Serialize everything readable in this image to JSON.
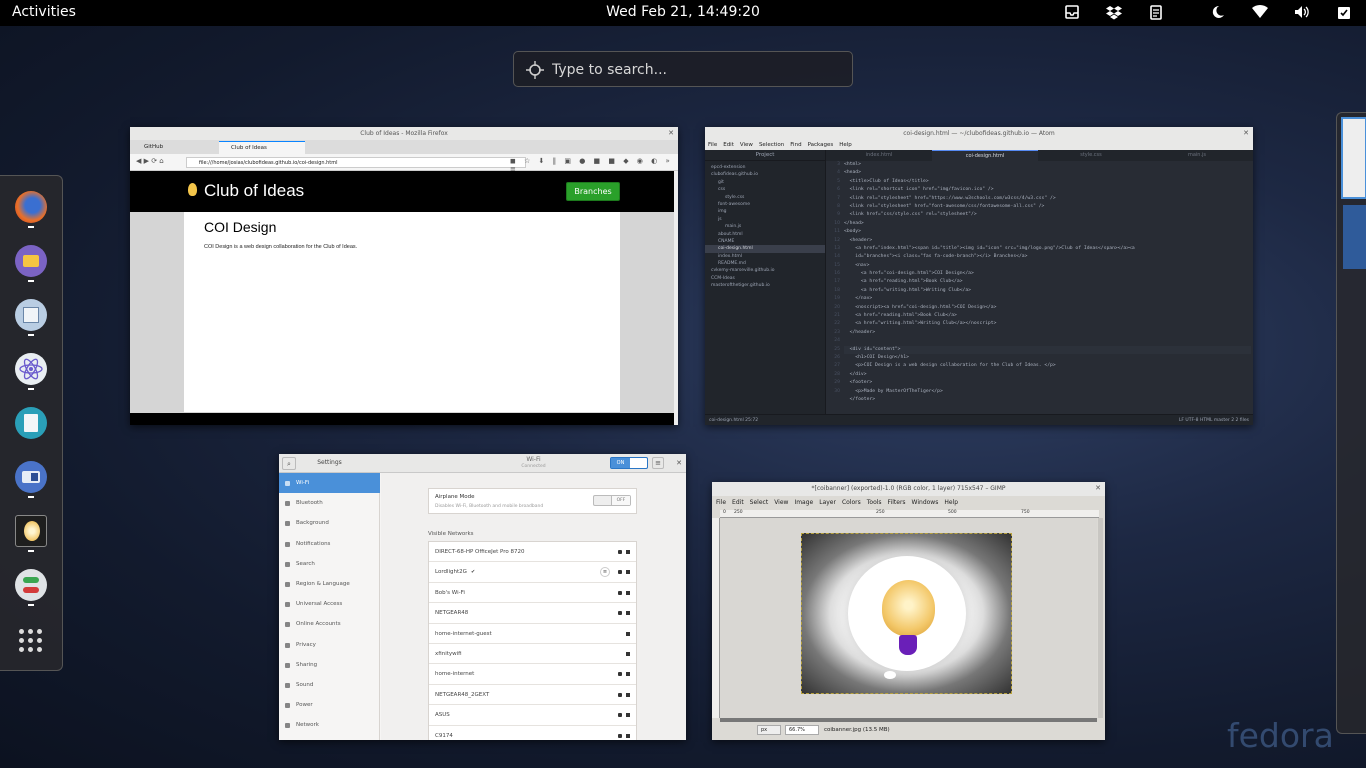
{
  "topbar": {
    "activities": "Activities",
    "clock": "Wed Feb 21, 14:49:20",
    "tray_icons": [
      "inbox-icon",
      "dropbox-icon",
      "clipboard-icon",
      "night-light-icon",
      "wifi-icon",
      "volume-icon",
      "system-menu-icon"
    ]
  },
  "search": {
    "placeholder": "Type to search..."
  },
  "dash": {
    "apps": [
      "firefox-icon",
      "files-icon",
      "settings-tweaks-icon",
      "atom-icon",
      "text-editor-icon",
      "boxes-icon",
      "gimp-icon",
      "toggles-icon"
    ],
    "show_apps": "show-applications-icon"
  },
  "firefox": {
    "title": "Club of Ideas - Mozilla Firefox",
    "tab1": "GitHub",
    "tab2": "Club of Ideas",
    "url": "file:///home/josias/clubofideas.github.io/coi-design.html",
    "site_title": "Club of Ideas",
    "branches": "Branches",
    "heading": "COI Design",
    "paragraph": "COI Design is a web design collaboration for the Club of Ideas."
  },
  "atom": {
    "title": "coi-design.html — ~/clubofideas.github.io — Atom",
    "menu": [
      "File",
      "Edit",
      "View",
      "Selection",
      "Find",
      "Packages",
      "Help"
    ],
    "tree_header": "Project",
    "tree": [
      "epcd-extension",
      "clubofideas.github.io",
      "git",
      "css",
      "style.css",
      "font-awesome",
      "img",
      "js",
      "main.js",
      "about.html",
      "CNAME",
      "coi-design.html",
      "index.html",
      "README.md",
      "cvkemy-marseville.github.io",
      "CCM-Ideas",
      "masterofthetiger.github.io"
    ],
    "tabs": [
      "index.html",
      "coi-design.html",
      "style.css",
      "main.js"
    ],
    "gutter": [
      "3",
      "4",
      "5",
      "6",
      "7",
      "8",
      "9",
      "10",
      "11",
      "12",
      "13",
      "14",
      "15",
      "16",
      "17",
      "18",
      "19",
      "20",
      "21",
      "22",
      "23",
      "24",
      "25",
      "26",
      "27",
      "28",
      "29",
      "30"
    ],
    "code": [
      "<html>",
      "<head>",
      "  <title>Club of Ideas</title>",
      "  <link rel=\"shortcut icon\" href=\"img/favicon.ico\" />",
      "  <link rel=\"stylesheet\" href=\"https://www.w3schools.com/w3css/4/w3.css\" />",
      "  <link rel=\"stylesheet\" href=\"font-awesome/css/fontawesome-all.css\" />",
      "  <link href=\"css/style.css\" rel=\"stylesheet\"/>",
      "</head>",
      "<body>",
      "  <header>",
      "    <a href=\"index.html\"><span id=\"title\"><img id=\"icon\" src=\"img/logo.png\"/>Club of Ideas</span></a><a",
      "    id=\"branches\"><i class=\"fas fa-code-branch\"></i> Branches</a>",
      "    <nav>",
      "      <a href=\"coi-design.html\">COI Design</a>",
      "      <a href=\"reading.html\">Book Club</a>",
      "      <a href=\"writing.html\">Writing Club</a>",
      "    </nav>",
      "    <noscript><a href=\"coi-design.html\">COI Design</a>",
      "    <a href=\"reading.html\">Book Club</a>",
      "    <a href=\"writing.html\">Writing Club</a></noscript>",
      "  </header>",
      "",
      "  <div id=\"content\">",
      "    <h1>COI Design</h1>",
      "    <p>COI Design is a web design collaboration for the Club of Ideas. </p>",
      "  </div>",
      "  <footer>",
      "    <p>Made by MasterOfTheTiger</p>",
      "  </footer>"
    ],
    "status_left": "coi-design.html   25:72",
    "status_right": "LF   UTF-8   HTML   master   2   2 files"
  },
  "settings": {
    "title": "Settings",
    "wifi_title": "Wi-Fi",
    "wifi_subtitle": "Connected",
    "wifi_toggle": "ON",
    "sidebar": [
      "Wi-Fi",
      "Bluetooth",
      "Background",
      "Notifications",
      "Search",
      "Region & Language",
      "Universal Access",
      "Online Accounts",
      "Privacy",
      "Sharing",
      "Sound",
      "Power",
      "Network"
    ],
    "airplane_title": "Airplane Mode",
    "airplane_desc": "Disables Wi-Fi, Bluetooth and mobile broadband",
    "airplane_toggle": "OFF",
    "visible_networks": "Visible Networks",
    "networks": [
      "DIRECT-68-HP OfficeJet Pro 8720",
      "Lordlight2G",
      "Bob's Wi-Fi",
      "NETGEAR48",
      "home-internet-guest",
      "xfinitywifi",
      "home-internet",
      "NETGEAR48_2GEXT",
      "ASUS",
      "C9174"
    ]
  },
  "gimp": {
    "title": "*[coibanner] (exported)-1.0 (RGB color, 1 layer) 715x547 – GIMP",
    "menu": [
      "File",
      "Edit",
      "Select",
      "View",
      "Image",
      "Layer",
      "Colors",
      "Tools",
      "Filters",
      "Windows",
      "Help"
    ],
    "ruler": [
      "0",
      "250",
      "250",
      "500",
      "750"
    ],
    "unit": "px",
    "zoom": "66.7%",
    "status": "coibanner.jpg (13.5 MB)"
  },
  "watermark": "fedora"
}
